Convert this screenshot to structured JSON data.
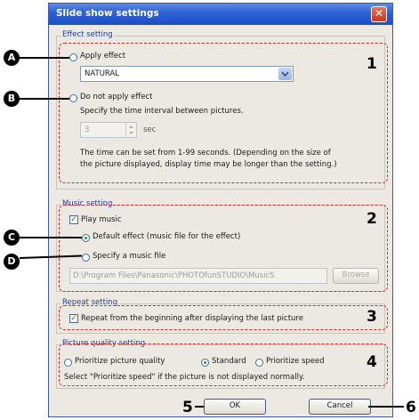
{
  "window": {
    "title": "Slide show settings",
    "close_glyph": "✕"
  },
  "effect": {
    "legend": "Effect setting",
    "apply_label": "Apply effect",
    "effect_value": "NATURAL",
    "not_apply_label": "Do not apply effect",
    "interval_prompt": "Specify the time interval between pictures.",
    "interval_value": "3",
    "interval_unit": "sec",
    "note_line1": "The time can be set from 1-99 seconds. (Depending on the size of",
    "note_line2": "the picture displayed, display time may be longer than the setting.)"
  },
  "music": {
    "legend": "Music setting",
    "play_label": "Play music",
    "default_label": "Default effect (music file for the effect)",
    "specify_label": "Specify a music file",
    "path_value": "D:\\Program Files\\Panasonic\\PHOTOfunSTUDIO\\MusicS",
    "browse_label": "Browse"
  },
  "repeat": {
    "legend": "Repeat setting",
    "repeat_label": "Repeat from the beginning after displaying the last picture"
  },
  "quality": {
    "legend": "Picture quality setting",
    "opt_quality": "Prioritize picture quality",
    "opt_standard": "Standard",
    "opt_speed": "Prioritize speed",
    "hint": "Select \"Prioritize speed\" if the picture is not displayed normally."
  },
  "buttons": {
    "ok": "OK",
    "cancel": "Cancel"
  },
  "callouts": {
    "a": "A",
    "b": "B",
    "c": "C",
    "d": "D"
  },
  "region_numbers": [
    "1",
    "2",
    "3",
    "4",
    "5",
    "6"
  ],
  "colors": {
    "title_bar": "#2f62d6",
    "annotation_dash": "#d52a2a",
    "window_bg": "#ebe9e1"
  }
}
